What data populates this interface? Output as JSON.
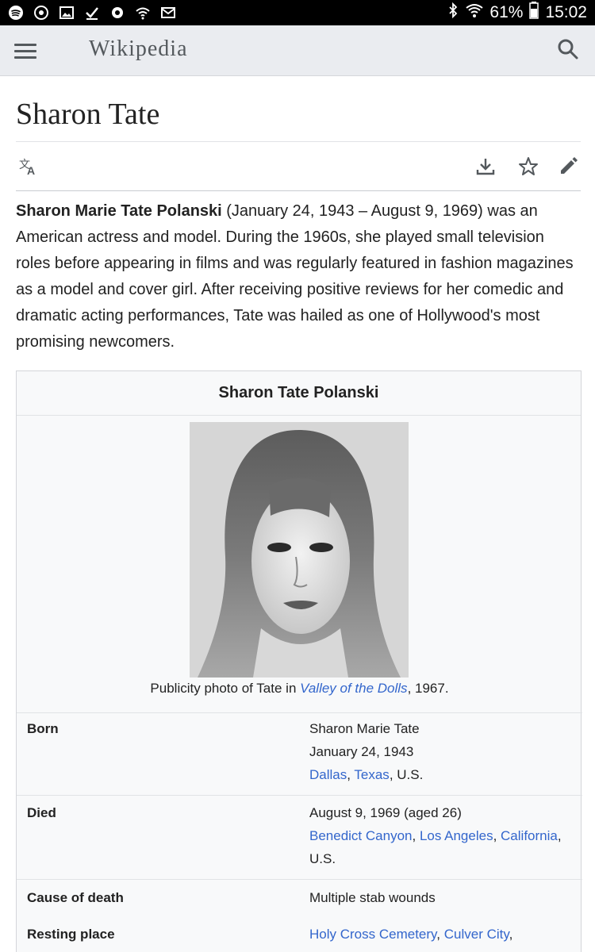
{
  "status_bar": {
    "battery": "61%",
    "time": "15:02",
    "icons": [
      "spotify-icon",
      "disc-icon",
      "image-icon",
      "check-icon",
      "gear-icon",
      "wifi-icon",
      "mail-icon",
      "bluetooth-icon",
      "wifi-signal-icon",
      "battery-icon"
    ]
  },
  "header": {
    "wordmark": "Wikipedia",
    "menu_icon": "hamburger-menu-icon",
    "search_icon": "search-icon"
  },
  "article": {
    "title": "Sharon Tate",
    "actions": {
      "language_icon": "language-icon",
      "download_icon": "download-icon",
      "watch_icon": "star-icon",
      "edit_icon": "edit-pencil-icon"
    },
    "lead_bold": "Sharon Marie Tate Polanski",
    "lead_rest": " (January 24, 1943 – August 9, 1969) was an American actress and model. During the 1960s, she played small television roles before appearing in films and was regularly featured in fashion magazines as a model and cover girl. After receiving positive reviews for her comedic and dramatic acting performances, Tate was hailed as one of Hollywood's most promising newcomers."
  },
  "infobox": {
    "title": "Sharon Tate Polanski",
    "caption_prefix": "Publicity photo of Tate in ",
    "caption_link": "Valley of the Dolls",
    "caption_suffix": ", 1967.",
    "born": {
      "label": "Born",
      "line1": "Sharon Marie Tate",
      "line2": "January 24, 1943",
      "place_city": "Dallas",
      "place_state": "Texas",
      "place_country": ", U.S."
    },
    "died": {
      "label": "Died",
      "line1": "August 9, 1969 (aged 26)",
      "place1": "Benedict Canyon",
      "place2": "Los Angeles",
      "place3": "California",
      "country": "U.S."
    },
    "cause": {
      "label": "Cause of death",
      "value": "Multiple stab wounds"
    },
    "resting": {
      "label": "Resting place",
      "place1": "Holy Cross Cemetery",
      "place2": "Culver City"
    }
  }
}
